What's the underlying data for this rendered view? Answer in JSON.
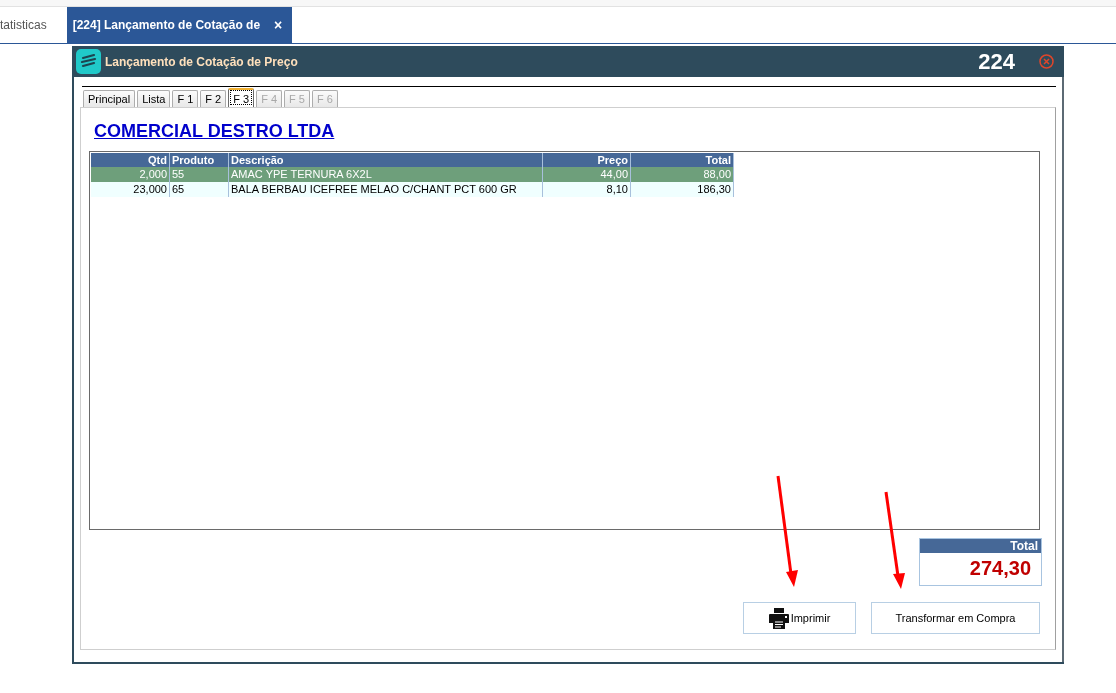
{
  "top_tabs": [
    {
      "label": "tatisticas",
      "selected": false
    },
    {
      "label": "[224] Lançamento de Cotação de",
      "selected": true,
      "close": "×"
    }
  ],
  "window": {
    "title": "Lançamento de Cotação de Preço",
    "number": "224"
  },
  "tabs": [
    {
      "label": "Principal",
      "selected": false,
      "disabled": false
    },
    {
      "label": "Lista",
      "selected": false,
      "disabled": false
    },
    {
      "label": "F 1",
      "selected": false,
      "disabled": false
    },
    {
      "label": "F 2",
      "selected": false,
      "disabled": false
    },
    {
      "label": "F 3",
      "selected": true,
      "disabled": false
    },
    {
      "label": "F 4",
      "selected": false,
      "disabled": true
    },
    {
      "label": "F 5",
      "selected": false,
      "disabled": true
    },
    {
      "label": "F 6",
      "selected": false,
      "disabled": true
    }
  ],
  "company": "COMERCIAL DESTRO LTDA",
  "table": {
    "columns": [
      "Qtd",
      "Produto",
      "Descrição",
      "Preço",
      "Total"
    ],
    "rows": [
      {
        "selected": true,
        "cells": [
          "2,000",
          "55",
          "AMAC YPE TERNURA 6X2L",
          "44,00",
          "88,00"
        ]
      },
      {
        "selected": false,
        "cells": [
          "23,000",
          "65",
          "BALA BERBAU ICEFREE MELAO C/CHANT PCT 600 GR",
          "8,10",
          "186,30"
        ]
      }
    ]
  },
  "total": {
    "label": "Total",
    "value": "274,30"
  },
  "buttons": [
    "Imprimir",
    "Transformar em Compra"
  ]
}
